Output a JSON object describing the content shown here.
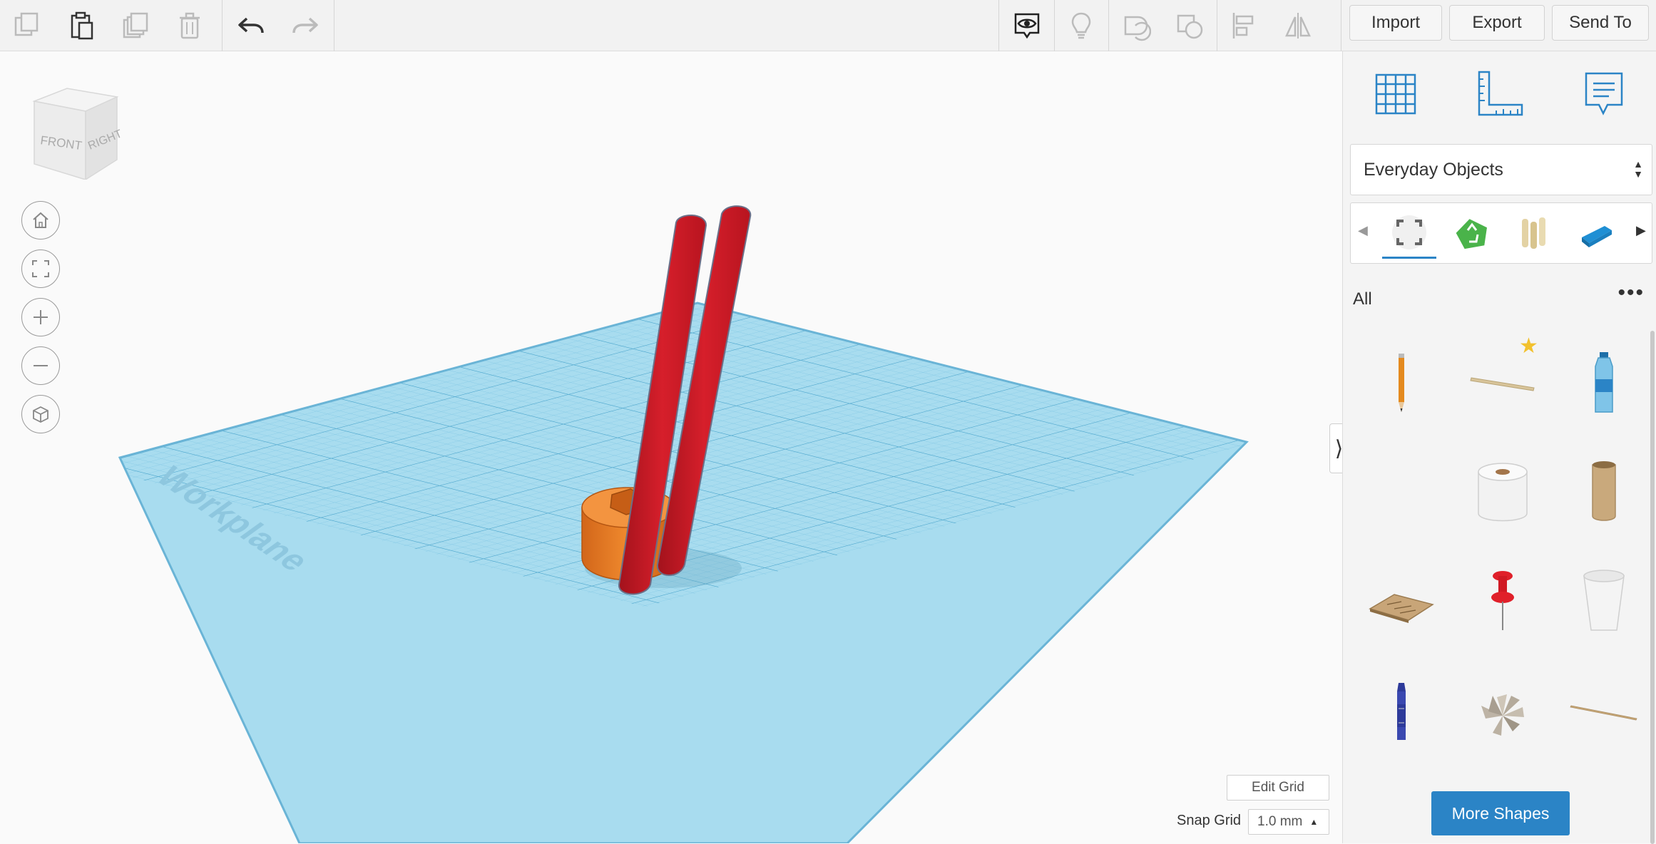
{
  "toolbar": {
    "left_tools": [
      "copy-icon",
      "paste-icon",
      "duplicate-icon",
      "delete-icon",
      "undo-icon",
      "redo-icon"
    ],
    "right_tools": [
      "show-all-icon",
      "notes-bulb-icon",
      "hole-icon",
      "group-icon",
      "align-icon",
      "mirror-icon"
    ],
    "import_label": "Import",
    "export_label": "Export",
    "send_to_label": "Send To"
  },
  "viewcube": {
    "front_label": "FRONT",
    "right_label": "RIGHT"
  },
  "view_controls": [
    "home-view-icon",
    "fit-view-icon",
    "zoom-in-icon",
    "zoom-out-icon",
    "ortho-view-icon"
  ],
  "workplane": {
    "label": "Workplane",
    "edit_grid_label": "Edit Grid",
    "snap_grid_label": "Snap Grid",
    "snap_grid_value": "1.0 mm"
  },
  "scene_objects": [
    {
      "name": "red-stick",
      "color": "#c81a25"
    },
    {
      "name": "red-stick",
      "color": "#c81a25"
    },
    {
      "name": "orange-ring",
      "color": "#e57522"
    }
  ],
  "panel": {
    "top_icons": [
      "grid-icon",
      "ruler-icon",
      "notes-icon"
    ],
    "library_selected": "Everyday Objects",
    "categories": [
      "all-shapes-icon",
      "recycle-icon",
      "sticks-icon",
      "stapler-icon"
    ],
    "filter_label": "All",
    "shapes": [
      "pencil",
      "wooden-stick",
      "water-bottle",
      "toilet-paper-roll",
      "cardboard-tube",
      "cork-board",
      "push-pin",
      "paper-cup",
      "crayon",
      "paper-fan",
      "skewer"
    ],
    "more_shapes_label": "More Shapes"
  },
  "colors": {
    "accent": "#2b84c6",
    "grid": "#8fd0ea",
    "grid_line": "#6fb7d6"
  }
}
